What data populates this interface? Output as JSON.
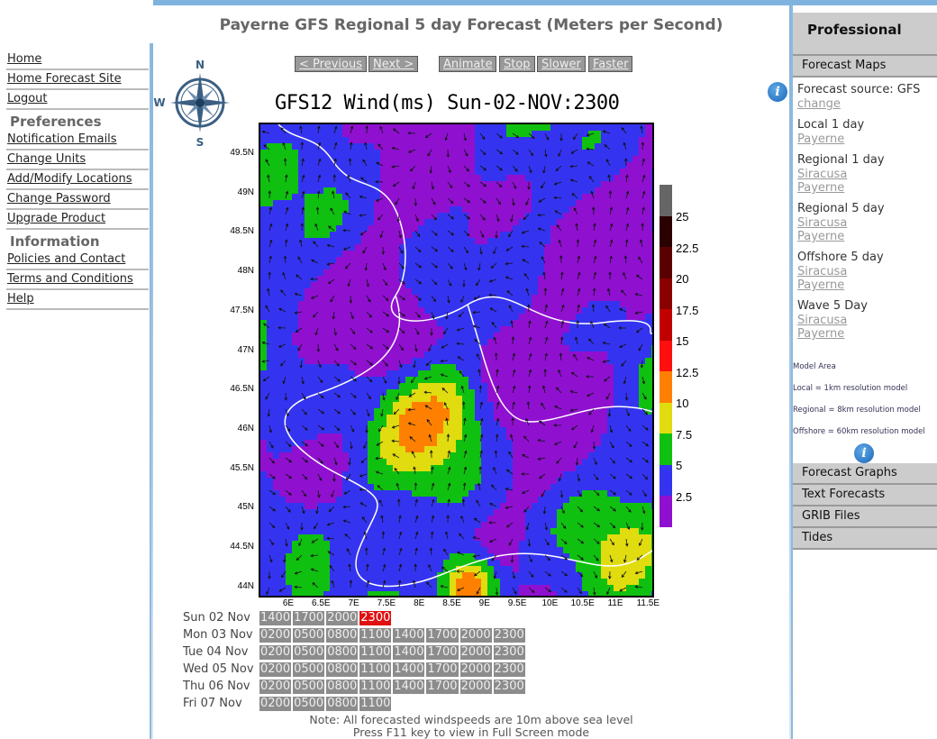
{
  "header": {
    "title": "Payerne GFS Regional 5 day Forecast (Meters per Second)"
  },
  "left_nav": {
    "items1": [
      "Home",
      "Home Forecast Site",
      "Logout"
    ],
    "pref_heading": "Preferences",
    "items2": [
      "Notification Emails",
      "Change Units",
      "Add/Modify Locations",
      "Change Password",
      "Upgrade Product"
    ],
    "info_heading": "Information",
    "items3": [
      "Policies and Contact",
      "Terms and Conditions",
      "Help"
    ]
  },
  "controls": {
    "previous": "< Previous",
    "next": "Next >",
    "animate": "Animate",
    "stop": "Stop",
    "slower": "Slower",
    "faster": "Faster"
  },
  "compass": {
    "n": "N",
    "w": "W",
    "s": "S"
  },
  "map": {
    "title": "GFS12 Wind(ms) Sun-02-NOV:2300",
    "lat_ticks": [
      "49.5N",
      "49N",
      "48.5N",
      "48N",
      "47.5N",
      "47N",
      "46.5N",
      "46N",
      "45.5N",
      "45N",
      "44.5N",
      "44N"
    ],
    "lon_ticks": [
      "6E",
      "6.5E",
      "7E",
      "7.5E",
      "8E",
      "8.5E",
      "9E",
      "9.5E",
      "10E",
      "10.5E",
      "11E",
      "11.5E"
    ],
    "legend_labels": [
      "25",
      "22.5",
      "20",
      "17.5",
      "15",
      "12.5",
      "10",
      "7.5",
      "5",
      "2.5"
    ],
    "legend_colors": [
      "#666666",
      "#2a0000",
      "#5a0000",
      "#8a0000",
      "#c00000",
      "#ff1010",
      "#ff8000",
      "#e0dc10",
      "#10c010",
      "#3434f0",
      "#9010d0"
    ]
  },
  "timeline": [
    {
      "day": "Sun 02 Nov",
      "times": [
        "1400",
        "1700",
        "2000",
        "2300"
      ],
      "selected": "2300"
    },
    {
      "day": "Mon 03 Nov",
      "times": [
        "0200",
        "0500",
        "0800",
        "1100",
        "1400",
        "1700",
        "2000",
        "2300"
      ]
    },
    {
      "day": "Tue 04 Nov",
      "times": [
        "0200",
        "0500",
        "0800",
        "1100",
        "1400",
        "1700",
        "2000",
        "2300"
      ]
    },
    {
      "day": "Wed 05 Nov",
      "times": [
        "0200",
        "0500",
        "0800",
        "1100",
        "1400",
        "1700",
        "2000",
        "2300"
      ]
    },
    {
      "day": "Thu 06 Nov",
      "times": [
        "0200",
        "0500",
        "0800",
        "1100",
        "1400",
        "1700",
        "2000",
        "2300"
      ]
    },
    {
      "day": "Fri 07 Nov",
      "times": [
        "0200",
        "0500",
        "0800",
        "1100"
      ]
    }
  ],
  "notes": [
    "Note: All forecasted windspeeds are 10m above sea level",
    "Press F11 key to view in Full Screen mode"
  ],
  "right": {
    "professional": "Professional",
    "forecast_maps": "Forecast Maps",
    "source_label": "Forecast source: GFS",
    "change": "change",
    "groups": [
      {
        "title": "Local 1 day",
        "links": [
          "Payerne"
        ]
      },
      {
        "title": "Regional 1 day",
        "links": [
          "Siracusa",
          "Payerne"
        ]
      },
      {
        "title": "Regional 5 day",
        "links": [
          "Siracusa",
          "Payerne"
        ]
      },
      {
        "title": "Offshore 5 day",
        "links": [
          "Siracusa",
          "Payerne"
        ]
      },
      {
        "title": "Wave 5 Day",
        "links": [
          "Siracusa",
          "Payerne"
        ]
      }
    ],
    "model_notes": [
      "Model Area",
      "Local = 1km resolution model",
      "Regional = 8km resolution model",
      "Offshore = 60km resolution model"
    ],
    "bottom_items": [
      "Forecast Graphs",
      "Text Forecasts",
      "GRIB Files",
      "Tides"
    ],
    "info_icon": "i"
  }
}
